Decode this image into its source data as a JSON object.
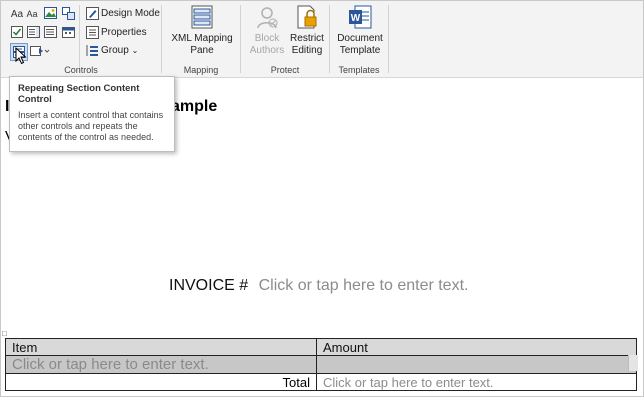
{
  "ribbon": {
    "controls": {
      "label": "Controls",
      "design_mode": "Design Mode",
      "properties": "Properties",
      "group": "Group",
      "text_aa_1": "Aa",
      "text_aa_2": "Aa"
    },
    "mapping": {
      "label": "Mapping",
      "xml_mapping_pane": "XML Mapping\nPane"
    },
    "protect": {
      "label": "Protect",
      "block_authors": "Block\nAuthors",
      "restrict_editing": "Restrict\nEditing"
    },
    "templates": {
      "label": "Templates",
      "document_template": "Document\nTemplate"
    }
  },
  "tooltip": {
    "title": "Repeating Section Content Control",
    "body": "Insert a content control that contains other controls and repeats the contents of the control as needed."
  },
  "document": {
    "title_visible": "ample",
    "left_marks": [
      "I",
      "V"
    ],
    "invoice_label": "INVOICE #",
    "placeholder": "Click or tap here to enter text.",
    "table": {
      "headers": [
        "Item",
        "Amount"
      ],
      "row_item_placeholder": "Click or tap here to enter text.",
      "total_label": "Total",
      "total_placeholder": "Click or tap here to enter text."
    }
  },
  "colors": {
    "word_blue": "#2b579a",
    "ribbon_bg": "#f3f3f3",
    "placeholder_gray": "#8c8c8c"
  }
}
